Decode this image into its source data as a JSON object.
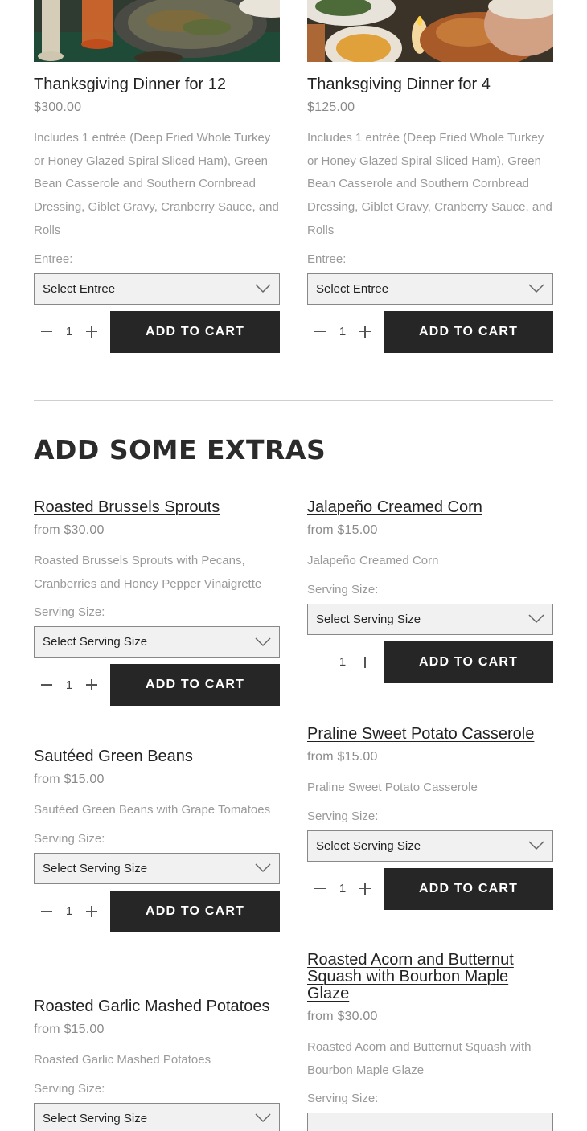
{
  "colors": {
    "button_bg": "#262626",
    "muted_text": "#9a9a9a",
    "divider": "#cfcfcf"
  },
  "dinners": [
    {
      "title": "Thanksgiving Dinner for 12",
      "price": "$300.00",
      "description": "Includes 1 entrée (Deep Fried Whole Turkey or Honey Glazed Spiral Sliced Ham), Green Bean Casserole and Southern Cornbread Dressing, Giblet Gravy, Cranberry Sauce, and Rolls",
      "option_label": "Entree:",
      "select_value": "Select Entree",
      "quantity": "1",
      "button_label": "ADD TO CART"
    },
    {
      "title": "Thanksgiving Dinner for 4",
      "price": "$125.00",
      "description": "Includes 1 entrée (Deep Fried Whole Turkey or Honey Glazed Spiral Sliced Ham), Green Bean Casserole and Southern Cornbread Dressing, Giblet Gravy, Cranberry Sauce, and Rolls",
      "option_label": "Entree:",
      "select_value": "Select Entree",
      "quantity": "1",
      "button_label": "ADD TO CART"
    }
  ],
  "extras_heading": "ADD SOME EXTRAS",
  "extras_left": [
    {
      "title": "Roasted Brussels Sprouts",
      "price": "from $30.00",
      "description": "Roasted Brussels Sprouts with Pecans, Cranberries and Honey Pepper Vinaigrette",
      "option_label": "Serving Size:",
      "select_value": "Select Serving Size",
      "quantity": "1",
      "button_label": "ADD TO CART"
    },
    {
      "title": "Sautéed Green Beans",
      "price": "from $15.00",
      "description": "Sautéed Green Beans with Grape Tomatoes",
      "option_label": "Serving Size:",
      "select_value": "Select Serving Size",
      "quantity": "1",
      "button_label": "ADD TO CART"
    },
    {
      "title": "Roasted Garlic Mashed Potatoes",
      "price": "from $15.00",
      "description": "Roasted Garlic Mashed Potatoes",
      "option_label": "Serving Size:",
      "select_value": "Select Serving Size"
    }
  ],
  "extras_right": [
    {
      "title": "Jalapeño Creamed Corn",
      "price": "from $15.00",
      "description": "Jalapeño Creamed Corn",
      "option_label": "Serving Size:",
      "select_value": "Select Serving Size",
      "quantity": "1",
      "button_label": "ADD TO CART"
    },
    {
      "title": "Praline Sweet Potato Casserole",
      "price": "from $15.00",
      "description": "Praline Sweet Potato Casserole",
      "option_label": "Serving Size:",
      "select_value": "Select Serving Size",
      "quantity": "1",
      "button_label": "ADD TO CART"
    },
    {
      "title": "Roasted Acorn and Butternut Squash with Bourbon Maple Glaze",
      "price": "from $30.00",
      "description": "Roasted Acorn and Butternut Squash with Bourbon Maple Glaze",
      "option_label": "Serving Size:"
    }
  ]
}
